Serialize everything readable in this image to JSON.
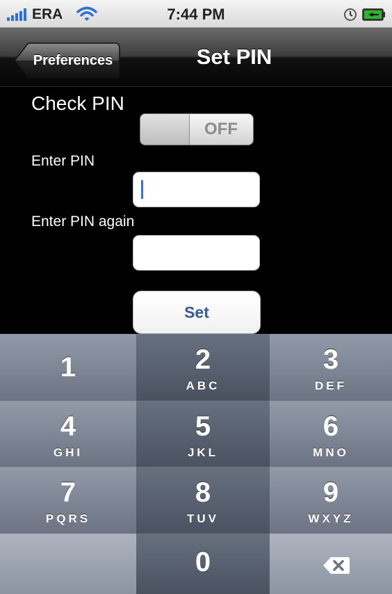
{
  "status_bar": {
    "carrier": "ERA",
    "time": "7:44 PM",
    "icons": [
      "signal-icon",
      "wifi-icon",
      "clock-icon",
      "battery-icon"
    ]
  },
  "nav_bar": {
    "back_label": "Preferences",
    "title": "Set PIN"
  },
  "form": {
    "check_pin_label": "Check PIN",
    "toggle_state": "OFF",
    "enter_pin_label": "Enter PIN",
    "enter_pin_value": "",
    "enter_pin_again_label": "Enter PIN again",
    "enter_pin_again_value": "",
    "set_button_label": "Set"
  },
  "keypad": {
    "keys": [
      {
        "digit": "1",
        "letters": ""
      },
      {
        "digit": "2",
        "letters": "ABC"
      },
      {
        "digit": "3",
        "letters": "DEF"
      },
      {
        "digit": "4",
        "letters": "GHI"
      },
      {
        "digit": "5",
        "letters": "JKL"
      },
      {
        "digit": "6",
        "letters": "MNO"
      },
      {
        "digit": "7",
        "letters": "PQRS"
      },
      {
        "digit": "8",
        "letters": "TUV"
      },
      {
        "digit": "9",
        "letters": "WXYZ"
      },
      {
        "digit": "0",
        "letters": ""
      }
    ],
    "delete_icon": "backspace-icon"
  },
  "colors": {
    "accent_blue": "#3a5a92",
    "caret_blue": "#3f6fd1",
    "nav_bar": "#1a1a1a",
    "key_dark": "#5a6270",
    "key_light": "#8c94a2"
  }
}
